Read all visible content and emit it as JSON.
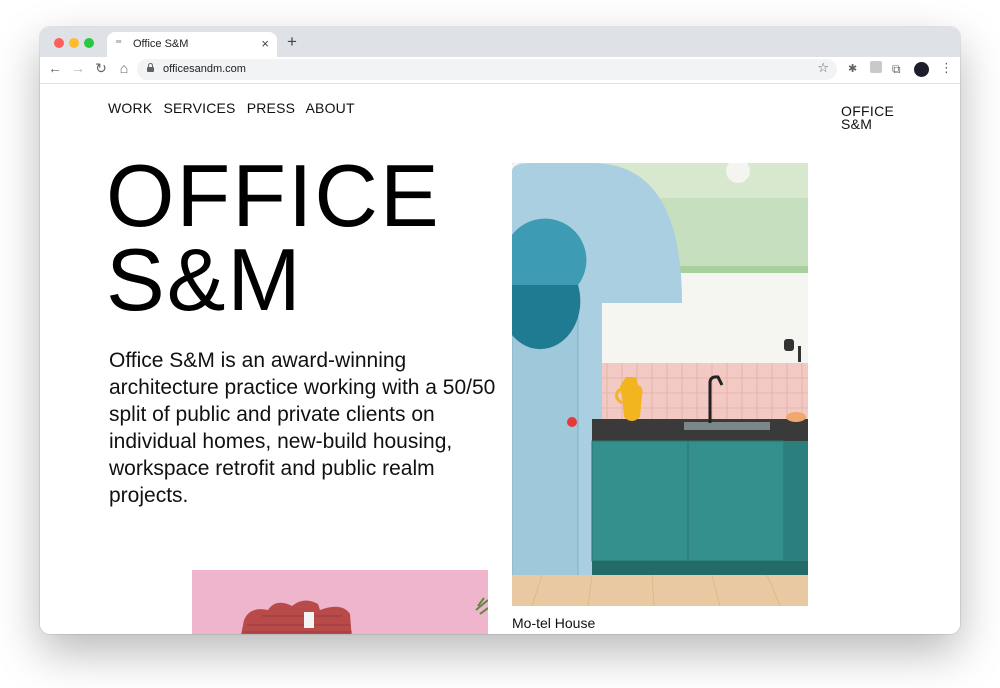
{
  "browser": {
    "tab_title": "Office S&M",
    "tab_favicon": "office-sm-favicon",
    "close_tab_glyph": "×",
    "new_tab_glyph": "+",
    "back_glyph": "←",
    "forward_glyph": "→",
    "reload_glyph": "↻",
    "home_glyph": "⌂",
    "url": "officesandm.com",
    "bookmark_glyph": "☆",
    "extension_glyph": "✱",
    "puzzle_glyph": "⧉",
    "menu_glyph": "⋮",
    "colors": {
      "tabstrip": "#dee1e6",
      "omnibox": "#f1f3f4"
    }
  },
  "site": {
    "nav": [
      "WORK",
      "SERVICES",
      "PRESS",
      "ABOUT"
    ],
    "brand_line1": "OFFICE",
    "brand_line2": "S&M",
    "hero_line1": "OFFICE",
    "hero_line2": "S&M",
    "description": "Office S&M is an award-winning architecture practice working with a 50/50 split of public and private clients on individual homes, new-build housing, workspace retrofit and public realm projects.",
    "featured_caption": "Mo-tel House",
    "colors": {
      "text": "#111111",
      "arch_blue": "#a9cfe0",
      "cabinet_teal": "#2f8a87",
      "wall_green": "#c6dfbf",
      "tile_pink": "#f2c9c3",
      "floor_wood": "#e8c9a1",
      "jug_yellow": "#f3b51f",
      "building_pink": "#eeb5cc",
      "brick_red": "#b94a4a"
    }
  }
}
